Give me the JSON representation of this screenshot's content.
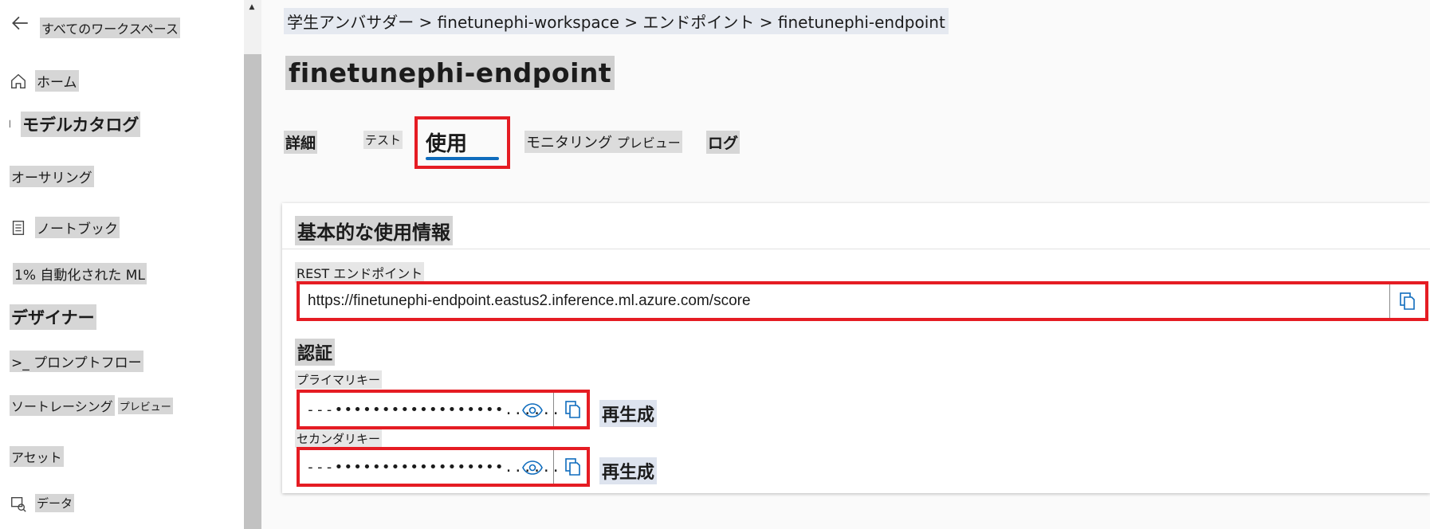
{
  "sidebar": {
    "back_label": "すべてのワークスペース",
    "items": [
      {
        "label": "ホーム",
        "icon": "home-icon"
      },
      {
        "label": "モデルカタログ",
        "icon": "catalog-icon"
      },
      {
        "label": "オーサリング",
        "icon": ""
      },
      {
        "label": "ノートブック",
        "icon": "notebook-icon"
      },
      {
        "label": "1% 自動化された ML",
        "icon": ""
      },
      {
        "label": "デザイナー",
        "icon": ""
      },
      {
        "label": ">_ プロンプトフロー",
        "icon": ""
      },
      {
        "label": "ソートレーシング",
        "badge": "プレビュー",
        "icon": ""
      },
      {
        "label": "アセット",
        "icon": ""
      },
      {
        "label": "データ",
        "icon": "data-icon"
      }
    ]
  },
  "breadcrumb": "学生アンバサダー > finetunephi-workspace > エンドポイント > finetunephi-endpoint",
  "page_title": "finetunephi-endpoint",
  "tabs": {
    "details": "詳細",
    "test": "テスト",
    "consume": "使用",
    "monitoring": "モニタリング",
    "monitoring_badge": "プレビュー",
    "logs": "ログ"
  },
  "card": {
    "basic_title": "基本的な使用情報",
    "rest_label": "REST エンドポイント",
    "rest_url": "https://finetunephi-endpoint.eastus2.inference.ml.azure.com/score",
    "auth_title": "認証",
    "primary_label": "プライマリキー",
    "primary_value": "---••••••••••••••••••......",
    "secondary_label": "セカンダリキー",
    "secondary_value": "---••••••••••••••••••......",
    "regenerate_label": "再生成"
  },
  "colors": {
    "highlight_red": "#e51c23",
    "accent_blue": "#0f6cbd"
  }
}
